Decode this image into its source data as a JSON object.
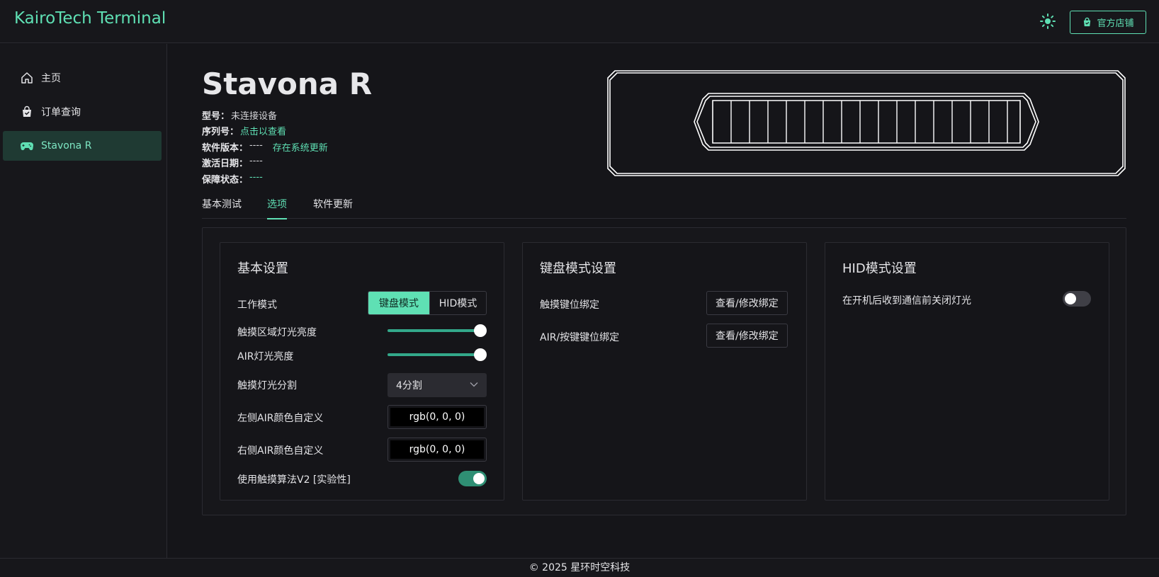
{
  "header": {
    "brand": "KairoTech Terminal",
    "theme_icon": "sun-icon",
    "store_icon": "shopping-bag-icon",
    "store_label": "官方店铺"
  },
  "sidebar": {
    "items": [
      {
        "label": "主页",
        "icon": "home-icon",
        "active": false
      },
      {
        "label": "订单查询",
        "icon": "order-bag-icon",
        "active": false
      },
      {
        "label": "Stavona R",
        "icon": "gamepad-icon",
        "active": true
      }
    ]
  },
  "device": {
    "name": "Stavona R",
    "model_label": "型号：",
    "model_value": "未连接设备",
    "serial_label": "序列号：",
    "serial_value": "点击以查看",
    "software_label": "软件版本：",
    "software_value": "----",
    "software_update_link": "存在系统更新",
    "activation_label": "激活日期：",
    "activation_value": "----",
    "warranty_label": "保障状态：",
    "warranty_value": "----"
  },
  "tabs": [
    {
      "label": "基本测试",
      "active": false
    },
    {
      "label": "选项",
      "active": true
    },
    {
      "label": "软件更新",
      "active": false
    }
  ],
  "basic_settings": {
    "title": "基本设置",
    "work_mode_label": "工作模式",
    "work_mode_options": [
      "键盘模式",
      "HID模式"
    ],
    "work_mode_selected": "键盘模式",
    "touch_brightness_label": "触摸区域灯光亮度",
    "touch_brightness_value": 1.0,
    "air_brightness_label": "AIR灯光亮度",
    "air_brightness_value": 1.0,
    "touch_split_label": "触摸灯光分割",
    "touch_split_value": "4分割",
    "left_air_color_label": "左侧AIR颜色自定义",
    "left_air_color_value": "rgb(0, 0, 0)",
    "right_air_color_label": "右侧AIR颜色自定义",
    "right_air_color_value": "rgb(0, 0, 0)",
    "touch_v2_label": "使用触摸算法V2 [实验性]",
    "touch_v2_enabled": true
  },
  "keyboard_settings": {
    "title": "键盘模式设置",
    "touch_binding_label": "触摸键位绑定",
    "touch_binding_button": "查看/修改绑定",
    "air_binding_label": "AIR/按键键位绑定",
    "air_binding_button": "查看/修改绑定"
  },
  "hid_settings": {
    "title": "HID模式设置",
    "lights_off_label": "在开机后收到通信前关闭灯光",
    "lights_off_enabled": false
  },
  "footer": {
    "text": "© 2025 星环时空科技"
  },
  "colors": {
    "accent": "#5fe0b4",
    "background": "#151519",
    "active_nav_bg": "#1f3a33"
  }
}
